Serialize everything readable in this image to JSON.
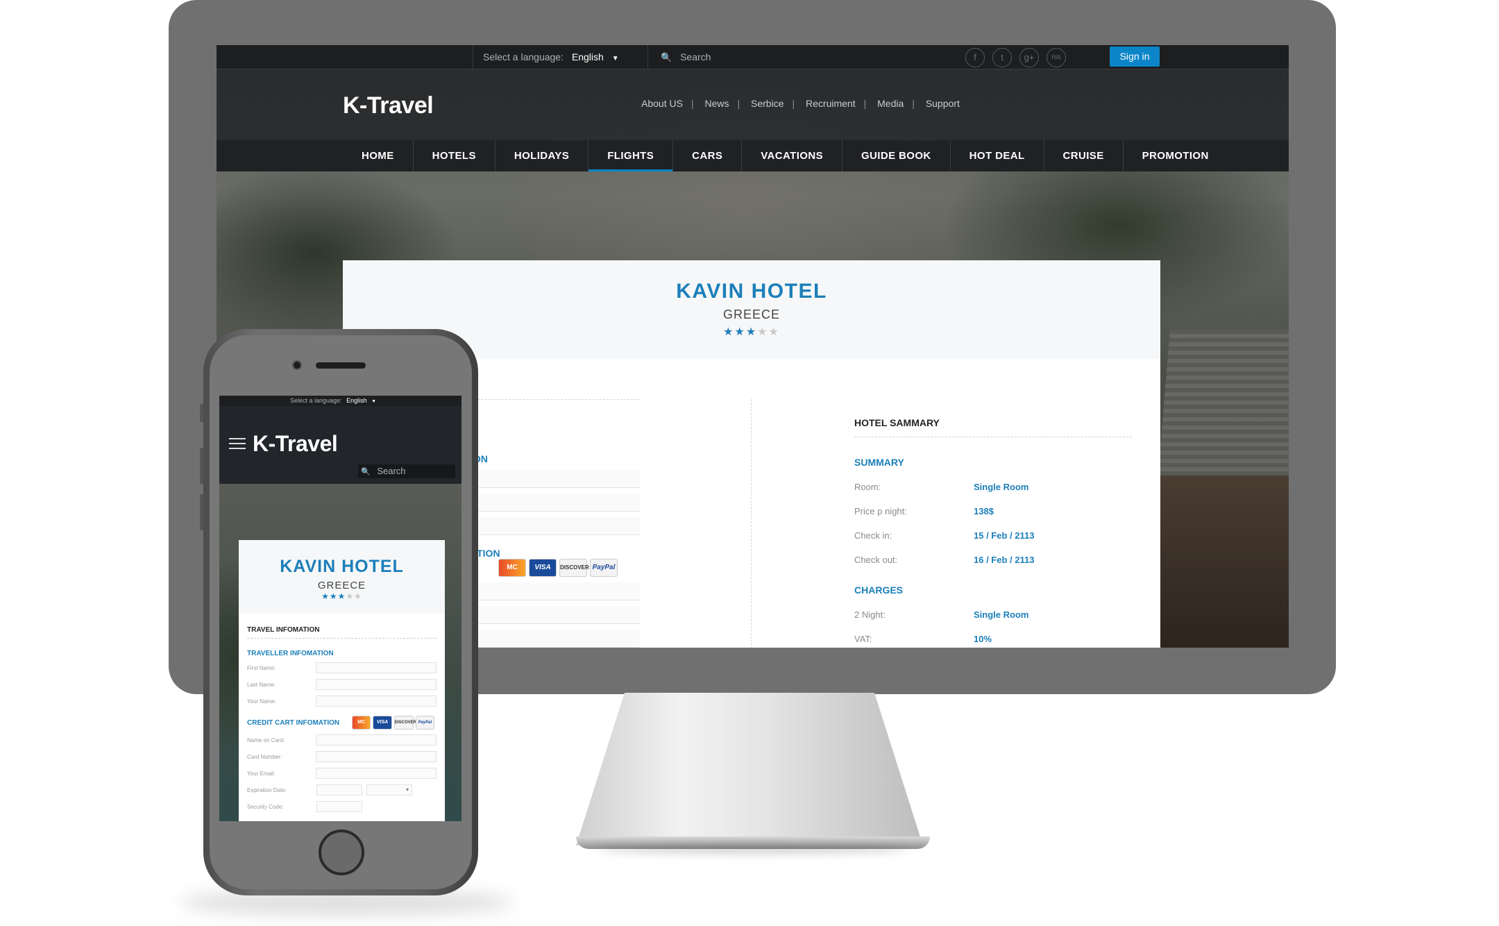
{
  "desktop": {
    "topbar": {
      "language_label": "Select a language:",
      "language_value": "English",
      "search_placeholder": "Search",
      "signin": "Sign in",
      "social": [
        "f",
        "t",
        "g+",
        "rss"
      ]
    },
    "header": {
      "logo": "K-Travel",
      "links": [
        "About US",
        "News",
        "Serbice",
        "Recruiment",
        "Media",
        "Support"
      ],
      "separator": "|"
    },
    "nav": {
      "items": [
        "HOME",
        "HOTELS",
        "HOLIDAYS",
        "FLIGHTS",
        "CARS",
        "VACATIONS",
        "GUIDE BOOK",
        "HOT DEAL",
        "CRUISE",
        "PROMOTION"
      ],
      "active": "FLIGHTS"
    },
    "hotel": {
      "name": "KAVIN HOTEL",
      "country": "GREECE",
      "rating": 3,
      "max_rating": 5
    },
    "left": {
      "section1_fragment": "ION",
      "section2_fragment": "ATION"
    },
    "payment_cards": [
      "MasterCard",
      "VISA",
      "DISCOVER",
      "PayPal"
    ],
    "summary": {
      "heading": "HOTEL SAMMARY",
      "summary_title": "SUMMARY",
      "rows": [
        {
          "label": "Room:",
          "value": "Single Room"
        },
        {
          "label": "Price p night:",
          "value": "138$"
        },
        {
          "label": "Check in:",
          "value": "15 / Feb / 2113"
        },
        {
          "label": "Check out:",
          "value": "16 / Feb / 2113"
        }
      ],
      "charges_title": "CHARGES",
      "charges": [
        {
          "label": "2 Night:",
          "value": "Single Room"
        },
        {
          "label": "VAT:",
          "value": "10%"
        }
      ]
    }
  },
  "mobile": {
    "language_label": "Select a language:",
    "language_value": "English",
    "logo": "K-Travel",
    "search_placeholder": "Search",
    "hotel_name": "KAVIN HOTEL",
    "hotel_country": "GREECE",
    "travel_info": "TRAVEL INFOMATION",
    "traveller_info": "TRAVELLER INFOMATION",
    "traveller_fields": [
      "First Name:",
      "Last Name:",
      "Your Name:"
    ],
    "credit_info": "CREDIT CART INFOMATION",
    "credit_fields": [
      "Name on Card:",
      "Card Number:",
      "Your Email:"
    ],
    "expiration_label": "Expiration Date:",
    "security_label": "Security Code:"
  },
  "colors": {
    "accent": "#0b85c8",
    "title_blue": "#1c7fba",
    "nav_bg": "#1f2124"
  }
}
